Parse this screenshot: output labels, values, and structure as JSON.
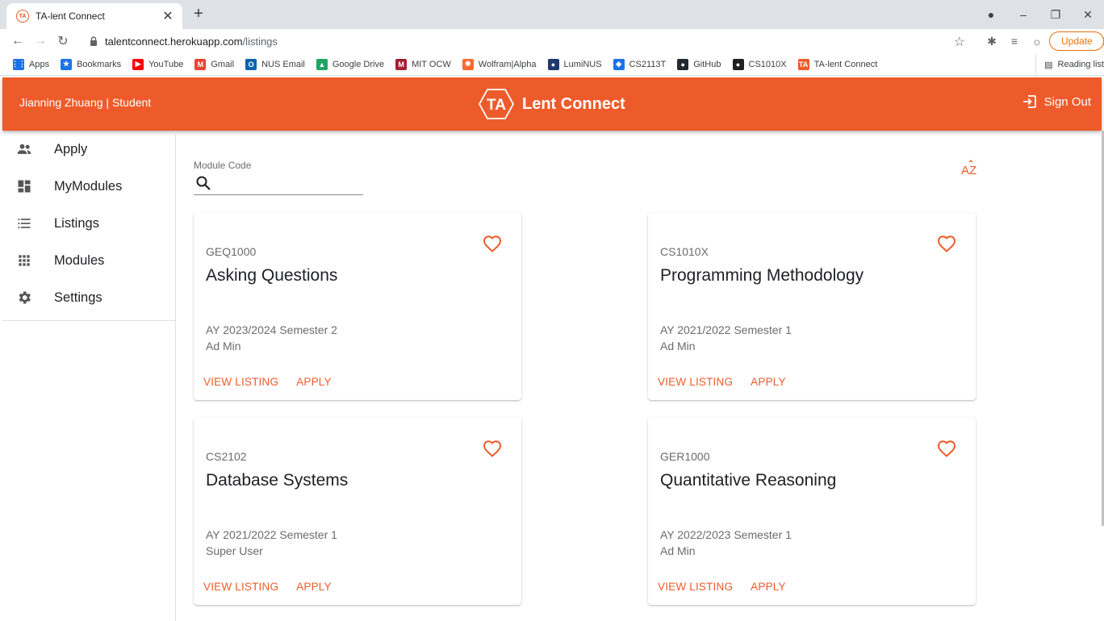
{
  "browser": {
    "tab_title": "TA-lent Connect",
    "tab_favicon_text": "TA",
    "url_host": "talentconnect.herokuapp.com",
    "url_path": "/listings",
    "update_label": "Update",
    "reading_list_label": "Reading list",
    "bookmarks": [
      {
        "label": "Apps",
        "icon": "apps-grid-icon",
        "color": "#1a73e8"
      },
      {
        "label": "Bookmarks",
        "icon": "star-icon",
        "color": "#1a73e8"
      },
      {
        "label": "YouTube",
        "icon": "youtube-icon",
        "color": "#ff0000"
      },
      {
        "label": "Gmail",
        "icon": "gmail-icon",
        "color": "#ea4335"
      },
      {
        "label": "NUS Email",
        "icon": "outlook-icon",
        "color": "#0a64ad"
      },
      {
        "label": "Google Drive",
        "icon": "drive-icon",
        "color": "#1fa463"
      },
      {
        "label": "MIT OCW",
        "icon": "mit-icon",
        "color": "#a31f34"
      },
      {
        "label": "Wolfram|Alpha",
        "icon": "wolfram-icon",
        "color": "#f96932"
      },
      {
        "label": "LumiNUS",
        "icon": "luminus-icon",
        "color": "#1e3a6e"
      },
      {
        "label": "CS2113T",
        "icon": "graduation-cap-icon",
        "color": "#1a73e8"
      },
      {
        "label": "GitHub",
        "icon": "github-icon",
        "color": "#24292e"
      },
      {
        "label": "CS1010X",
        "icon": "cs1010x-icon",
        "color": "#202124"
      },
      {
        "label": "TA-lent Connect",
        "icon": "talent-connect-icon",
        "color": "#ee5b2a"
      }
    ]
  },
  "app": {
    "user_label": "Jianning Zhuang | Student",
    "brand_logo_text": "TA",
    "brand_title": "Lent Connect",
    "sign_out_label": "Sign Out",
    "accent_color": "#ee5b2a"
  },
  "sidebar": {
    "items": [
      {
        "label": "Apply",
        "icon": "people-icon"
      },
      {
        "label": "MyModules",
        "icon": "dashboard-icon"
      },
      {
        "label": "Listings",
        "icon": "list-icon"
      },
      {
        "label": "Modules",
        "icon": "apps-icon"
      },
      {
        "label": "Settings",
        "icon": "gear-icon"
      }
    ]
  },
  "search": {
    "label": "Module Code",
    "value": ""
  },
  "sort_icon_text": "AZ",
  "listings": [
    {
      "code": "GEQ1000",
      "title": "Asking Questions",
      "term": "AY 2023/2024 Semester 2",
      "admin": "Ad Min",
      "view_label": "VIEW LISTING",
      "apply_label": "APPLY"
    },
    {
      "code": "CS1010X",
      "title": "Programming Methodology",
      "term": "AY 2021/2022 Semester 1",
      "admin": "Ad Min",
      "view_label": "VIEW LISTING",
      "apply_label": "APPLY"
    },
    {
      "code": "CS2102",
      "title": "Database Systems",
      "term": "AY 2021/2022 Semester 1",
      "admin": "Super User",
      "view_label": "VIEW LISTING",
      "apply_label": "APPLY"
    },
    {
      "code": "GER1000",
      "title": "Quantitative Reasoning",
      "term": "AY 2022/2023 Semester 1",
      "admin": "Ad Min",
      "view_label": "VIEW LISTING",
      "apply_label": "APPLY"
    }
  ]
}
